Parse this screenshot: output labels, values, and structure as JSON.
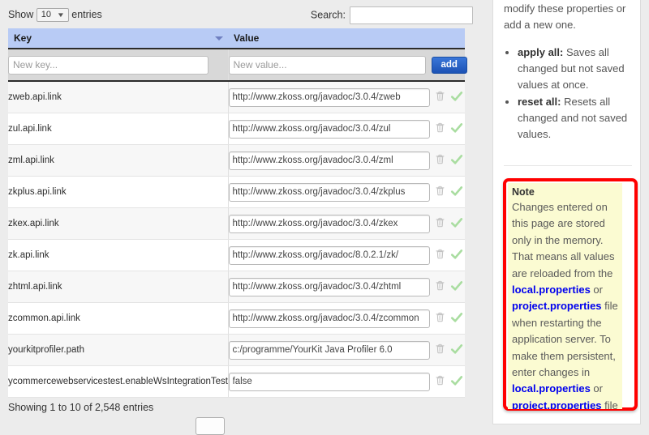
{
  "table_controls": {
    "show_label_prefix": "Show",
    "page_length": "10",
    "show_label_suffix": "entries",
    "search_label": "Search:",
    "search_value": "",
    "search_placeholder": ""
  },
  "table": {
    "columns": [
      "Key",
      "Value"
    ],
    "sort_column": "Key",
    "sort_direction": "desc",
    "new_row": {
      "key_placeholder": "New key...",
      "key_value": "",
      "value_placeholder": "New value...",
      "value_value": "",
      "add_label": "add"
    },
    "rows": [
      {
        "key": "zweb.api.link",
        "value": "http://www.zkoss.org/javadoc/3.0.4/zweb"
      },
      {
        "key": "zul.api.link",
        "value": "http://www.zkoss.org/javadoc/3.0.4/zul"
      },
      {
        "key": "zml.api.link",
        "value": "http://www.zkoss.org/javadoc/3.0.4/zml"
      },
      {
        "key": "zkplus.api.link",
        "value": "http://www.zkoss.org/javadoc/3.0.4/zkplus"
      },
      {
        "key": "zkex.api.link",
        "value": "http://www.zkoss.org/javadoc/3.0.4/zkex"
      },
      {
        "key": "zk.api.link",
        "value": "http://www.zkoss.org/javadoc/8.0.2.1/zk/"
      },
      {
        "key": "zhtml.api.link",
        "value": "http://www.zkoss.org/javadoc/3.0.4/zhtml"
      },
      {
        "key": "zcommon.api.link",
        "value": "http://www.zkoss.org/javadoc/3.0.4/zcommon"
      },
      {
        "key": "yourkitprofiler.path",
        "value": "c:/programme/YourKit Java Profiler 6.0"
      },
      {
        "key": "ycommercewebservicestest.enableWsIntegrationTest",
        "value": "false"
      }
    ],
    "row_action_icons": [
      "trash-icon",
      "confirm-check-icon"
    ],
    "info_text": "Showing 1 to 10 of 2,548 entries"
  },
  "help_panel": {
    "intro": "modify these properties or add a new one.",
    "bullets": [
      {
        "term": "apply all:",
        "text": " Saves all changed but not saved values at once."
      },
      {
        "term": "reset all:",
        "text": " Resets all changed and not saved values."
      }
    ]
  },
  "note": {
    "title": "Note",
    "segments": [
      {
        "type": "text",
        "text": "Changes entered on this page are stored only in the memory. That means all values are reloaded from the "
      },
      {
        "type": "link",
        "text": "local.properties"
      },
      {
        "type": "text",
        "text": " or "
      },
      {
        "type": "link",
        "text": "project.properties"
      },
      {
        "type": "text",
        "text": " file when restarting the application server. To make them persistent, enter changes in "
      },
      {
        "type": "link",
        "text": "local.properties"
      },
      {
        "type": "text",
        "text": " or "
      },
      {
        "type": "link",
        "text": "project.properties"
      },
      {
        "type": "text",
        "text": " file directly."
      }
    ]
  },
  "colors": {
    "header_bg": "#b8cbf5",
    "add_button": "#2360c8",
    "note_border": "#ff0000",
    "note_bg": "#fbfbd2",
    "note_link": "#0000ee",
    "page_bg": "#ececec"
  }
}
